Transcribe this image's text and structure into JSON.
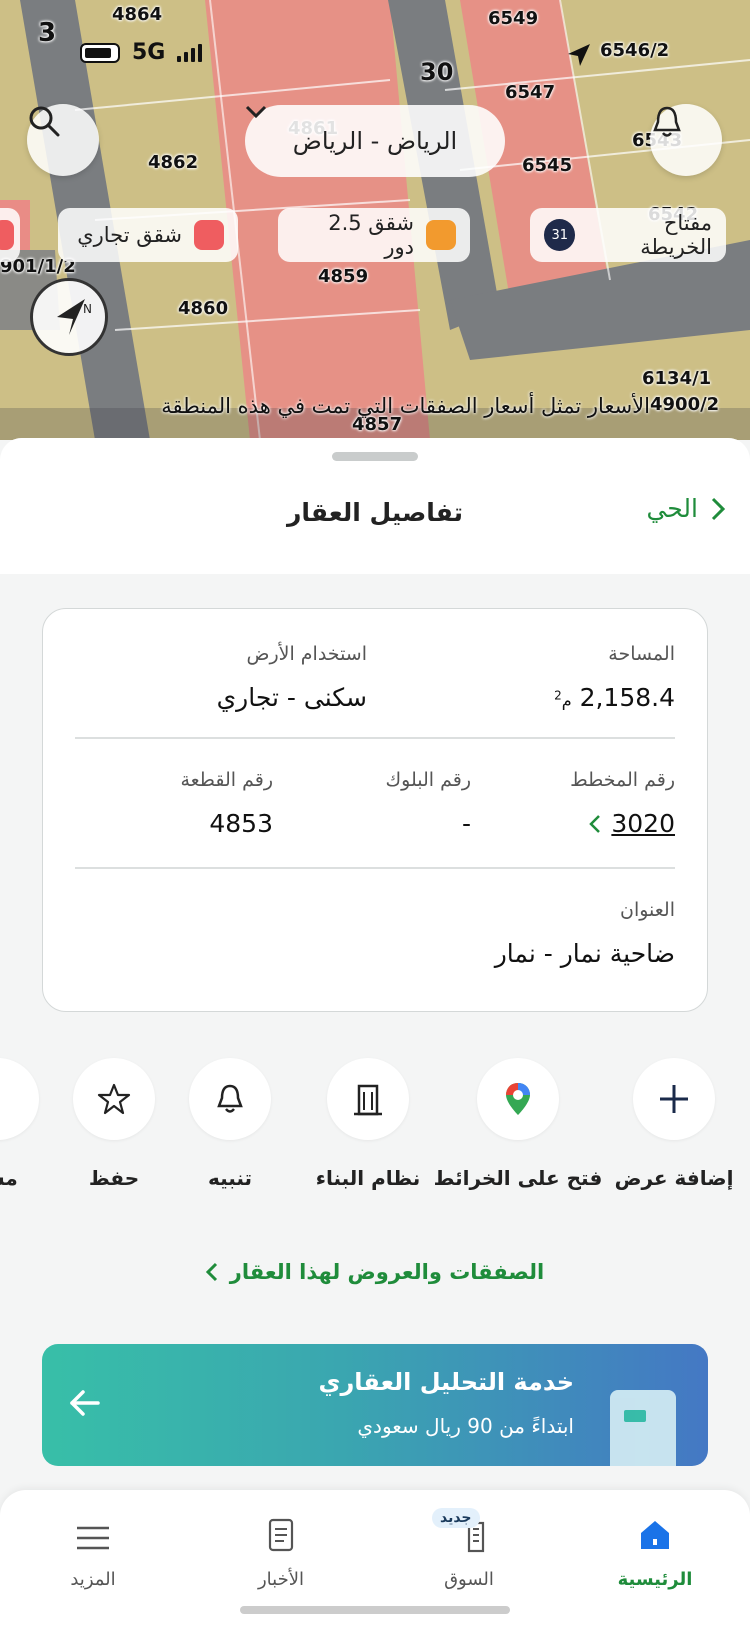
{
  "status_bar": {
    "network": "5G"
  },
  "map": {
    "city_selector": "الرياض - الرياض",
    "legend": [
      {
        "label": "مفتاح الخريطة",
        "badge": "31"
      },
      {
        "label": "شقق 2.5 دور",
        "color": "#f29a2e"
      },
      {
        "label": "شقق تجاري",
        "color": "#ef5d60"
      }
    ],
    "street_number": "30",
    "plot_numbers": [
      "4864",
      "6549",
      "6546/2",
      "6547",
      "4861",
      "4862",
      "6545",
      "6543",
      "6542",
      "4859",
      "4860",
      "901/1/2",
      "6134/1",
      "4900/2",
      "4857",
      "3"
    ],
    "note": "الأسعار تمثل أسعار الصفقات التي تمت في هذه المنطقة",
    "icons": [
      "search-icon",
      "bell-icon",
      "compass-icon",
      "chevron-down-icon",
      "location-arrow-icon"
    ]
  },
  "sheet": {
    "title": "تفاصيل العقار",
    "back_label": "الحي"
  },
  "details": {
    "area_label": "المساحة",
    "area_value": "2,158.4",
    "area_unit": "م",
    "area_sup": "2",
    "land_use_label": "استخدام الأرض",
    "land_use_value": "سكنى - تجاري",
    "plan_label": "رقم المخطط",
    "plan_value": "3020",
    "block_label": "رقم البلوك",
    "block_value": "-",
    "plot_label": "رقم القطعة",
    "plot_value": "4853",
    "address_label": "العنوان",
    "address_value": "ضاحية نمار - نمار"
  },
  "actions": [
    {
      "label": "إضافة عرض",
      "icon": "plus-icon"
    },
    {
      "label": "فتح على الخرائط",
      "icon": "map-pin-icon"
    },
    {
      "label": "نظام البناء",
      "icon": "building-icon"
    },
    {
      "label": "تنبيه",
      "icon": "bell-icon"
    },
    {
      "label": "حفظ",
      "icon": "star-icon"
    },
    {
      "label": "مشـ",
      "icon": "share-icon"
    }
  ],
  "deals_link": "الصفقات والعروض لهذا العقار",
  "banner": {
    "title": "خدمة التحليل العقاري",
    "subtitle": "ابتداءً من 90 ريال سعودي"
  },
  "tabs": [
    {
      "label": "الرئيسية",
      "icon": "home-icon",
      "active": true
    },
    {
      "label": "السوق",
      "icon": "market-icon",
      "badge": "جديد"
    },
    {
      "label": "الأخبار",
      "icon": "news-icon"
    },
    {
      "label": "المزيد",
      "icon": "menu-icon"
    }
  ],
  "colors": {
    "accent": "#1f8c3b",
    "commercial": "#ef5d60",
    "apartments": "#f29a2e"
  }
}
